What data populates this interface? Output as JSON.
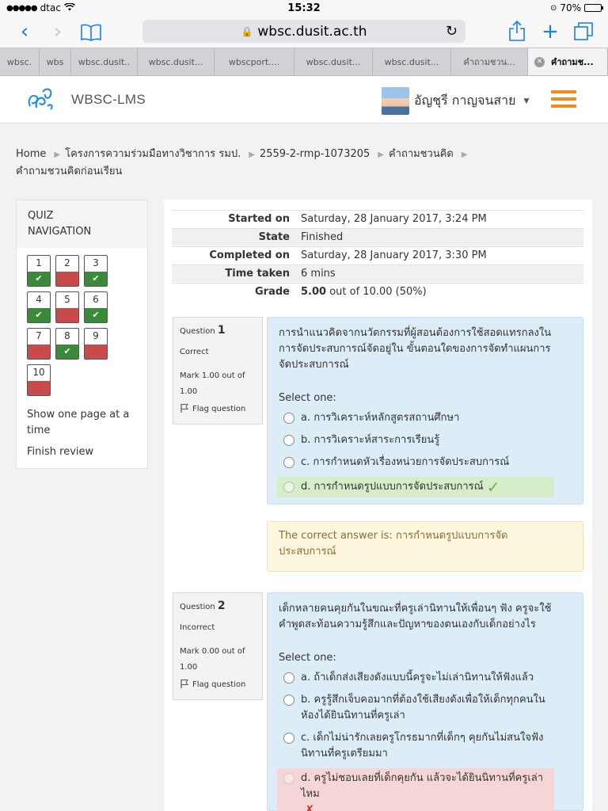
{
  "status_bar": {
    "carrier": "dtac",
    "time": "15:32",
    "battery": "70%"
  },
  "browser": {
    "url": "wbsc.dusit.ac.th",
    "tabs": [
      "wbsc.",
      "wbs",
      "wbsc.dusit..",
      "wbsc.dusit...",
      "wbscport....",
      "wbsc.dusit...",
      "wbsc.dusit...",
      "คำถามชวน...",
      "คำถามช..."
    ]
  },
  "header": {
    "brand": "WBSC-LMS",
    "user_name": "อัญชุรี กาญจนสาย"
  },
  "breadcrumb": [
    "Home",
    "โครงการความร่วมมือทางวิชาการ รมป.",
    "2559-2-rmp-1073205",
    "คำถามชวนคิด",
    "คำถามชวนคิดก่อนเรียน"
  ],
  "quiz_nav": {
    "title_line1": "QUIZ",
    "title_line2": "NAVIGATION",
    "questions": [
      {
        "num": "1",
        "result": "correct"
      },
      {
        "num": "2",
        "result": "incorrect"
      },
      {
        "num": "3",
        "result": "correct"
      },
      {
        "num": "4",
        "result": "correct"
      },
      {
        "num": "5",
        "result": "incorrect"
      },
      {
        "num": "6",
        "result": "correct"
      },
      {
        "num": "7",
        "result": "incorrect"
      },
      {
        "num": "8",
        "result": "correct"
      },
      {
        "num": "9",
        "result": "incorrect"
      },
      {
        "num": "10",
        "result": "incorrect"
      }
    ],
    "show_one_page": "Show one page at a time",
    "finish_review": "Finish review"
  },
  "summary": {
    "started_on_label": "Started on",
    "started_on": "Saturday, 28 January 2017, 3:24 PM",
    "state_label": "State",
    "state": "Finished",
    "completed_on_label": "Completed on",
    "completed_on": "Saturday, 28 January 2017, 3:30 PM",
    "time_taken_label": "Time taken",
    "time_taken": "6 mins",
    "grade_label": "Grade",
    "grade_value": "5.00",
    "grade_rest": "out of 10.00 (50%)"
  },
  "questions": [
    {
      "label": "Question",
      "number": "1",
      "status": "Correct",
      "mark_line1": "Mark 1.00 out of",
      "mark_line2": "1.00",
      "flag": "Flag question",
      "text_line1": "การนำแนวคิดจากนวัตกรรมที่ผู้สอนต้องการใช้สอดแทรกลงใน",
      "text_line2": "การจัดประสบการณ์จัดอยู่ใน ขั้นตอนใดของการจัดทำแผนการ",
      "text_line3": "จัดประสบการณ์",
      "select_one": "Select one:",
      "options": [
        "a. การวิเคราะห์หลักสูตรสถานศึกษา",
        "b. การวิเคราะห์สาระการเรียนรู้",
        "c. การกำหนดหัวเรื่องหน่วยการจัดประสบการณ์",
        "d. การกำหนดรูปแบบการจัดประสบการณ์"
      ],
      "correct_answer_line1": "The correct answer is: การกำหนดรูปแบบการจัด",
      "correct_answer_line2": "ประสบการณ์"
    },
    {
      "label": "Question",
      "number": "2",
      "status": "Incorrect",
      "mark_line1": "Mark 0.00 out of",
      "mark_line2": "1.00",
      "flag": "Flag question",
      "text_line1": "เด็กหลายคนคุยกันในขณะที่ครูเล่านิทานให้เพื่อนๆ ฟัง ครูจะใช้",
      "text_line2": "คำพูดสะท้อนความรู้สึกและปัญหาของตนเองกับเด็กอย่างไร",
      "select_one": "Select one:",
      "options": [
        "a. ถ้าเด็กส่งเสียงดังแบบนี้ครูจะไม่เล่านิทานให้ฟังแล้ว",
        "b. ครูรู้สึกเจ็บคอมากที่ต้องใช้เสียงดังเพื่อให้เด็กทุกคนใน",
        "หัองได้ยินนิทานที่ครูเล่า",
        "c. เด็กไม่น่ารักเลยครูโกรธมากที่เด็กๆ คุยกันไม่สนใจฟัง",
        "นิทานที่ครูเตรียมมา",
        "d. ครูไม่ชอบเลยที่เด็กคุยกัน แล้วจะได้ยินนิทานที่ครูเล่าไหม"
      ]
    }
  ],
  "colors": {
    "correct": "#3a8a3a",
    "incorrect": "#c94a4a",
    "accent": "#f28a1e",
    "safari_blue": "#1a7cf5"
  }
}
